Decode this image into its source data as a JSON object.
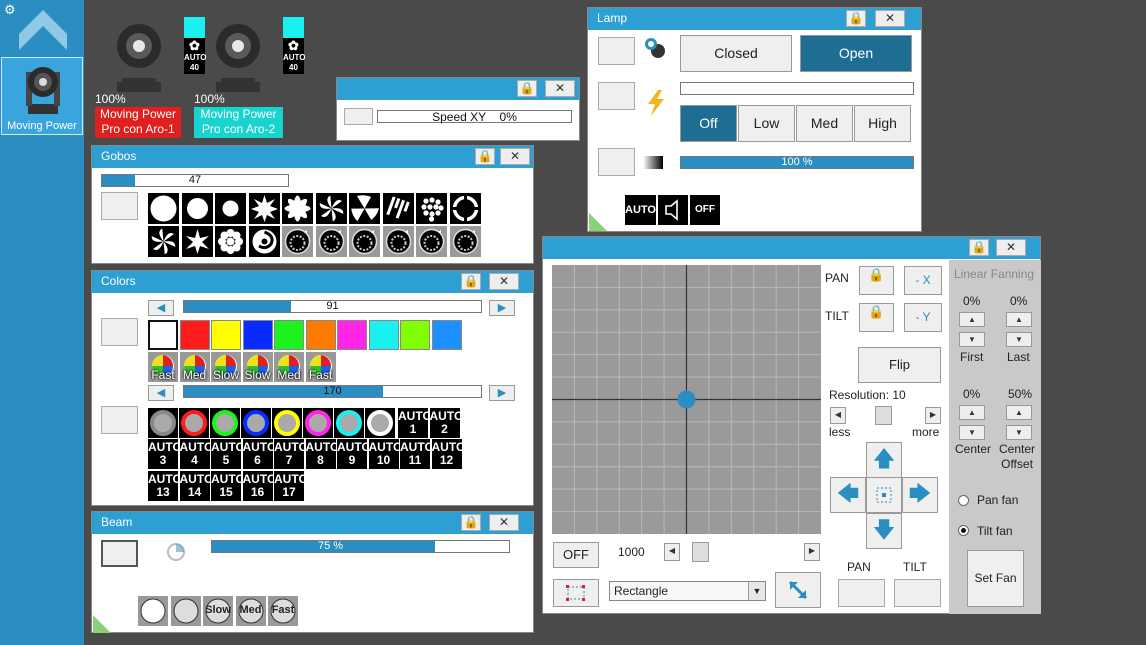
{
  "sidebar": {
    "gear": "⚙",
    "item_label": "Moving Power"
  },
  "fixtures": [
    {
      "percent": "100%",
      "name_line1": "Moving Power",
      "name_line2": "Pro con Aro-1",
      "color": "#e0201e",
      "auto": "AUTO",
      "auto_sub": "40"
    },
    {
      "percent": "100%",
      "name_line1": "Moving Power",
      "name_line2": "Pro con Aro-2",
      "color": "#19d3cf",
      "auto": "AUTO",
      "auto_sub": "40"
    }
  ],
  "speed_panel": {
    "label": "Speed XY",
    "value": "0%",
    "fill": 0
  },
  "gobos": {
    "title": "Gobos",
    "bar_value": "47",
    "fill": 0.18
  },
  "colors": {
    "title": "Colors",
    "bar1_value": "91",
    "bar1_fill": 0.36,
    "bar2_value": "170",
    "bar2_fill": 0.67,
    "swatches": [
      "#ffffff",
      "#ff1c1c",
      "#ffff00",
      "#0a2bff",
      "#1cf21c",
      "#ff7a00",
      "#ff24e6",
      "#1af0f0",
      "#7fff00",
      "#1e90ff"
    ],
    "fx": [
      "Fast",
      "Med",
      "Slow",
      "Slow",
      "Med",
      "Fast"
    ],
    "rings": [
      "#888888",
      "#ff1c1c",
      "#1cf21c",
      "#0a2bff",
      "#ffff00",
      "#ff24e6",
      "#1af0f0",
      "#ffffff"
    ],
    "auto_tiles": [
      [
        "AUTO",
        "1"
      ],
      [
        "AUTO",
        "2"
      ],
      [
        "AUTO",
        "3"
      ],
      [
        "AUTO",
        "4"
      ],
      [
        "AUTO",
        "5"
      ],
      [
        "AUTO",
        "6"
      ],
      [
        "AUTO",
        "7"
      ],
      [
        "AUTO",
        "8"
      ],
      [
        "AUTO",
        "9"
      ],
      [
        "AUTO",
        "10"
      ],
      [
        "AUTO",
        "11"
      ],
      [
        "AUTO",
        "12"
      ],
      [
        "AUTO",
        "13"
      ],
      [
        "AUTO",
        "14"
      ],
      [
        "AUTO",
        "15"
      ],
      [
        "AUTO",
        "16"
      ],
      [
        "AUTO",
        "17"
      ]
    ]
  },
  "beam": {
    "title": "Beam",
    "bar_value": "75 %",
    "fill": 0.75,
    "fx": [
      "Slow",
      "Med",
      "Fast"
    ]
  },
  "lamp": {
    "title": "Lamp",
    "closed": "Closed",
    "open": "Open",
    "off": "Off",
    "low": "Low",
    "med": "Med",
    "high": "High",
    "dimmer_value": "100 %",
    "dimmer_fill": 1.0,
    "auto": "AUTO",
    "off_tile": "OFF"
  },
  "pantilt": {
    "pan_label": "PAN",
    "tilt_label": "TILT",
    "minus_x": "- X",
    "minus_y": "- Y",
    "flip": "Flip",
    "resolution": "Resolution: 10",
    "less": "less",
    "more": "more",
    "off_btn": "OFF",
    "speed_value": "1000",
    "shape": "Rectangle",
    "pan_bottom": "PAN",
    "tilt_bottom": "TILT"
  },
  "fanning": {
    "title": "Linear Fanning",
    "first_pct": "0%",
    "last_pct": "0%",
    "first": "First",
    "last": "Last",
    "center_pct": "0%",
    "offset_pct": "50%",
    "center": "Center",
    "center_offset_1": "Center",
    "center_offset_2": "Offset",
    "pan_fan": "Pan fan",
    "tilt_fan": "Tilt fan",
    "set_fan": "Set Fan"
  }
}
